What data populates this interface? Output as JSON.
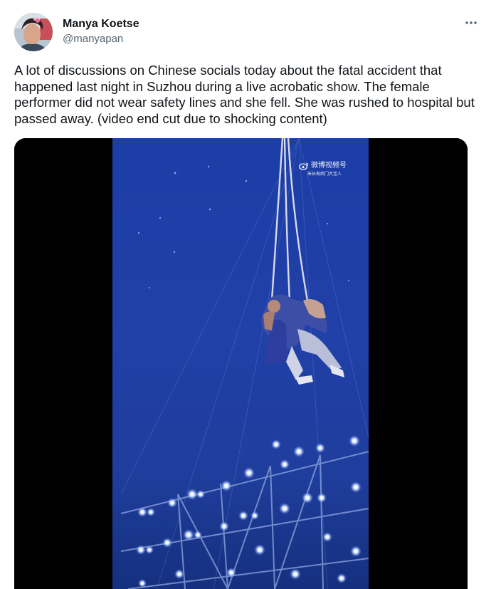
{
  "user": {
    "display_name": "Manya Koetse",
    "handle": "@manyapan"
  },
  "menu": {
    "icon": "more-horizontal-icon"
  },
  "tweet": {
    "text": "A lot of discussions on Chinese socials today about the fatal accident that happened last night in Suzhou during a live acrobatic show. The female performer did not wear safety lines and she fell. She was rushed to hospital but passed away. (video end cut due to shocking content)"
  },
  "media": {
    "watermark": "微博视频号",
    "watermark_sub": "米长寿西门大宝人"
  },
  "colors": {
    "text": "#0f1419",
    "secondary_text": "#536471",
    "video_background": "#000000",
    "stage_blue": "#1a3fa8"
  }
}
